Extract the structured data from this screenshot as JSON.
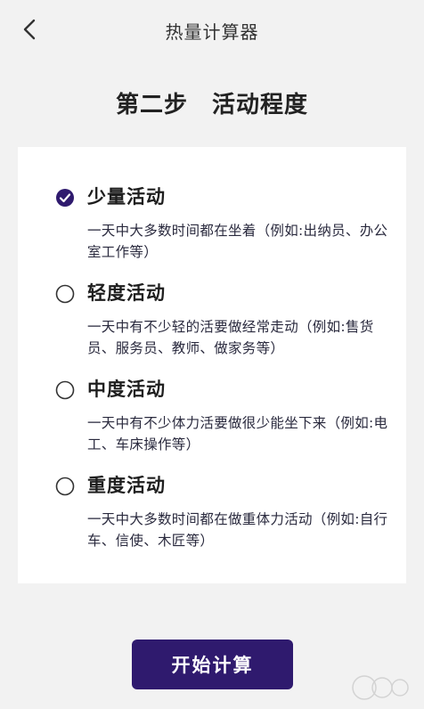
{
  "header": {
    "title": "热量计算器",
    "back_icon": "chevron-left-icon"
  },
  "step_title": "第二步　活动程度",
  "options": [
    {
      "label": "少量活动",
      "description": "一天中大多数时间都在坐着（例如:出纳员、办公室工作等）",
      "selected": true
    },
    {
      "label": "轻度活动",
      "description": "一天中有不少轻的活要做经常走动（例如:售货员、服务员、教师、做家务等）",
      "selected": false
    },
    {
      "label": "中度活动",
      "description": "一天中有不少体力活要做很少能坐下来（例如:电工、车床操作等）",
      "selected": false
    },
    {
      "label": "重度活动",
      "description": "一天中大多数时间都在做重体力活动（例如:自行车、信使、木匠等）",
      "selected": false
    }
  ],
  "start_button": "开始计算",
  "colors": {
    "accent": "#2f1a6e",
    "background": "#f2f2f2",
    "card": "#ffffff"
  }
}
